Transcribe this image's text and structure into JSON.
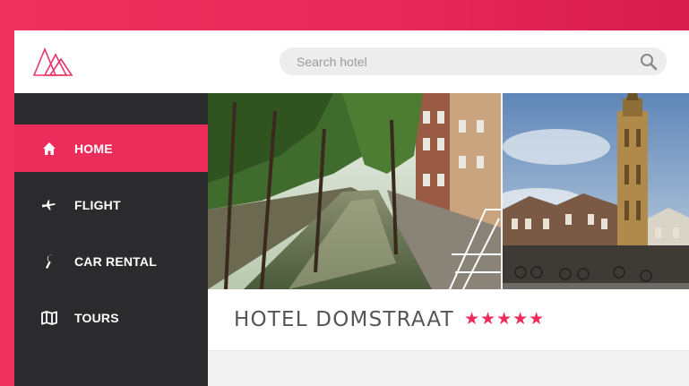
{
  "search": {
    "placeholder": "Search hotel"
  },
  "nav": {
    "items": [
      {
        "label": "HOME",
        "icon": "home-icon",
        "active": true
      },
      {
        "label": "FLIGHT",
        "icon": "plane-icon",
        "active": false
      },
      {
        "label": "CAR RENTAL",
        "icon": "wrench-icon",
        "active": false
      },
      {
        "label": "TOURS",
        "icon": "map-icon",
        "active": false
      }
    ]
  },
  "hotel": {
    "name": "HOTEL DOMSTRAAT",
    "stars": "★★★★★",
    "rating": 5
  },
  "colors": {
    "accent": "#ec2d5c",
    "sidebar": "#2b2b2d",
    "search_bg": "#ededed"
  }
}
